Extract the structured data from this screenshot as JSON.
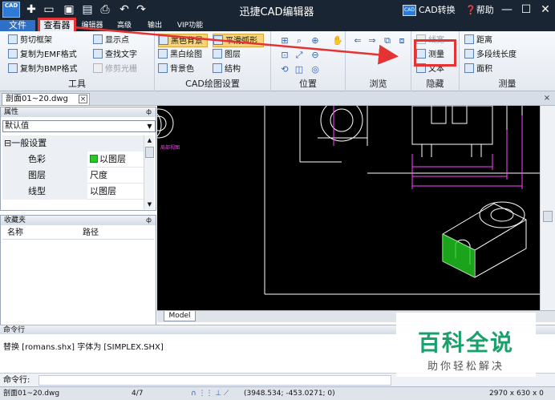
{
  "titlebar": {
    "app_icon_label": "CAD",
    "title": "迅捷CAD编辑器",
    "cad_convert": "CAD转换",
    "cad_badge": "CAD",
    "help": "帮助",
    "quick_access": [
      "new-icon",
      "open-icon",
      "save-icon",
      "save-as-icon",
      "print-icon",
      "undo-icon",
      "redo-icon"
    ]
  },
  "menu": {
    "items": [
      "文件",
      "查看器",
      "编辑器",
      "高级",
      "输出",
      "VIP功能"
    ],
    "active": "查看器",
    "highlight_color": "#e53232"
  },
  "ribbon": {
    "tools": {
      "label": "工具",
      "items": [
        "剪切框架",
        "复制为EMF格式",
        "复制为BMP格式",
        "显示点",
        "查找文字",
        "修剪光栅"
      ]
    },
    "cad_settings": {
      "label": "CAD绘图设置",
      "items": [
        "黑色背景",
        "黑白绘图",
        "背景色",
        "平滑弧形",
        "图层",
        "结构"
      ]
    },
    "position": {
      "label": "位置"
    },
    "browse": {
      "label": "浏览"
    },
    "hide": {
      "label": "隐藏",
      "items": [
        "线宽",
        "测量",
        "文本"
      ]
    },
    "measure": {
      "label": "测量",
      "items": [
        "距离",
        "多段线长度",
        "面积"
      ]
    }
  },
  "tabs": {
    "document": "剖面01~20.dwg",
    "close": "×"
  },
  "properties": {
    "title": "属性",
    "pin": "ф",
    "select_value": "默认值",
    "section": "一般设置",
    "section_toggle": "⊟",
    "rows": [
      {
        "key": "色彩",
        "value": "以图层"
      },
      {
        "key": "图层",
        "value": "尺度"
      },
      {
        "key": "线型",
        "value": "以图层"
      }
    ],
    "color_swatch": "#22cc22"
  },
  "favorites": {
    "title": "收藏夹",
    "pin": "ф",
    "col_name": "名称",
    "col_path": "路径"
  },
  "canvas": {
    "model_tab": "Model",
    "background": "#000000",
    "stroke": "#ffffff",
    "dimension_color": "#ff44ff",
    "hatch_color": "#22cc22",
    "small_label": "局部视图"
  },
  "command": {
    "title": "命令行",
    "output": "替换 [romans.shx] 字体为 [SIMPLEX.SHX]",
    "input_label": "命令行:"
  },
  "watermark": {
    "main": "百科全说",
    "sub": "助你轻松解决"
  },
  "status": {
    "file": "剖面01~20.dwg",
    "page": "4/7",
    "coords": "(3948.534; -453.0271; 0)",
    "size": "2970 x 630 x 0"
  }
}
